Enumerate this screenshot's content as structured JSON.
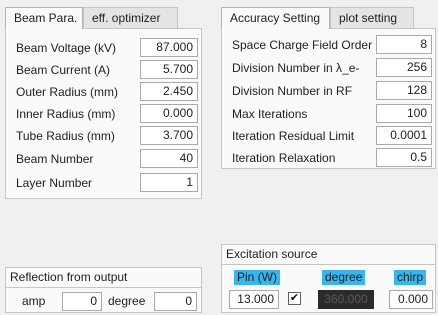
{
  "left_tabs": [
    {
      "label": "Beam Para.",
      "active": true
    },
    {
      "label": "eff. optimizer",
      "active": false
    }
  ],
  "beam_params": [
    {
      "label": "Beam Voltage (kV)",
      "value": "87.000"
    },
    {
      "label": "Beam Current (A)",
      "value": "5.700"
    },
    {
      "label": "Outer Radius (mm)",
      "value": "2.450"
    },
    {
      "label": "Inner Radius (mm)",
      "value": "0.000"
    },
    {
      "label": "Tube Radius (mm)",
      "value": "3.700"
    },
    {
      "label": "Beam Number",
      "value": "40"
    },
    {
      "label": "Layer Number",
      "value": "1"
    }
  ],
  "right_tabs": [
    {
      "label": "Accuracy Setting",
      "active": true
    },
    {
      "label": "plot setting",
      "active": false
    }
  ],
  "accuracy_params": [
    {
      "label": "Space Charge Field Order",
      "value": "8"
    },
    {
      "label": "Division Number in λ_e-",
      "value": "256"
    },
    {
      "label": "Division Number in RF",
      "value": "128"
    },
    {
      "label": "Max Iterations",
      "value": "100"
    },
    {
      "label": "Iteration Residual Limit",
      "value": "0.0001"
    },
    {
      "label": "Iteration Relaxation",
      "value": "0.5"
    }
  ],
  "reflection": {
    "title": "Reflection from output",
    "amp_label": "amp",
    "amp_value": "0",
    "degree_label": "degree",
    "degree_value": "0"
  },
  "excitation": {
    "title": "Excitation source",
    "pin_label": "Pin (W)",
    "degree_label": "degree",
    "chirp_label": "chirp",
    "pin_value": "13.000",
    "checkbox_checked": true,
    "checkbox_mark": "✔",
    "degree_value": "360.000",
    "chirp_value": "0.000",
    "highlight_color": "#3ab5ec"
  }
}
